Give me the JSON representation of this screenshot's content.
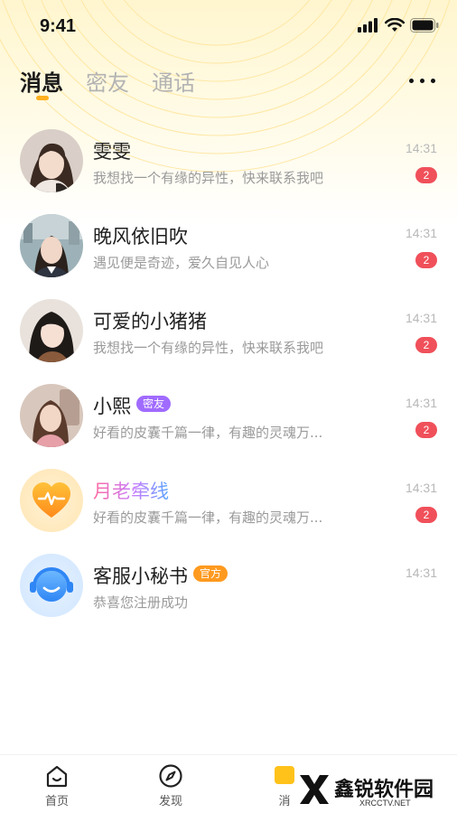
{
  "status_bar": {
    "time": "9:41"
  },
  "tabs": [
    {
      "label": "消息",
      "active": true
    },
    {
      "label": "密友",
      "active": false
    },
    {
      "label": "通话",
      "active": false
    }
  ],
  "conversations": [
    {
      "name": "雯雯",
      "preview": "我想找一个有缘的异性，快来联系我吧",
      "time": "14:31",
      "unread": "2",
      "tag": "",
      "avatar": "girl-photo-1"
    },
    {
      "name": "晚风依旧吹",
      "preview": "遇见便是奇迹，爱久自见人心",
      "time": "14:31",
      "unread": "2",
      "tag": "",
      "avatar": "girl-photo-2"
    },
    {
      "name": "可爱的小猪猪",
      "preview": "我想找一个有缘的异性，快来联系我吧",
      "time": "14:31",
      "unread": "2",
      "tag": "",
      "avatar": "girl-photo-3"
    },
    {
      "name": "小熙",
      "preview": "好看的皮囊千篇一律，有趣的灵魂万...",
      "time": "14:31",
      "unread": "2",
      "tag": "密友",
      "avatar": "girl-photo-4"
    },
    {
      "name": "月老牵线",
      "preview": "好看的皮囊千篇一律，有趣的灵魂万...",
      "time": "14:31",
      "unread": "2",
      "tag": "",
      "avatar": "heart-pulse-icon"
    },
    {
      "name": "客服小秘书",
      "preview": "恭喜您注册成功",
      "time": "14:31",
      "unread": "",
      "tag": "官方",
      "avatar": "headset-smile-icon"
    }
  ],
  "bottom_nav": [
    {
      "label": "首页",
      "icon": "home-icon"
    },
    {
      "label": "发现",
      "icon": "compass-icon"
    },
    {
      "label": "消",
      "icon": "message-icon"
    }
  ],
  "watermark": {
    "text": "鑫锐软件园",
    "sub": "XRCCTV.NET"
  },
  "colors": {
    "accent": "#ffb020",
    "badge": "#f0505a",
    "tag_friend": "#a06bff",
    "tag_official": "#ff9a1f"
  }
}
